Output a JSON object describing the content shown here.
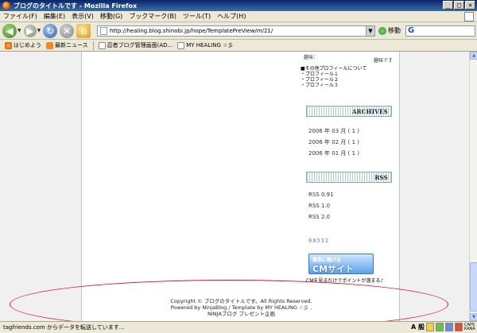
{
  "window": {
    "title": "ブログのタイトルです - Mozilla Firefox",
    "min": "_",
    "max": "□",
    "close": "×"
  },
  "menu": [
    "ファイル(F)",
    "編集(E)",
    "表示(V)",
    "移動(G)",
    "ブックマーク(B)",
    "ツール(T)",
    "ヘルプ(H)"
  ],
  "nav": {
    "url": "http://healing.blog.shinobi.jp/hope/TemplatePreView/m/21/",
    "go_label": "移動",
    "search_placeholder": ""
  },
  "bookmarks": [
    "はじめよう",
    "最新ニュース",
    "忍者ブログ管理画面(AD...",
    "MY HEALING ☆彡"
  ],
  "sidebar": {
    "profile_label": "趣味：",
    "profile_hobby": "趣味です",
    "other_profile": {
      "heading": "■その他プロフィールについて",
      "items": [
        "・プロフィール１",
        "・プロフィール２",
        "・プロフィール３"
      ]
    },
    "archives_heading": "ARCHIVES",
    "archives": [
      "2006 年 03 月 ( 1 )",
      "2006 年 02 月 ( 1 )",
      "2006 年 01 月 ( 1 )"
    ],
    "rss_heading": "RSS",
    "rss_links": [
      "RSS 0.91",
      "RSS 1.0",
      "RSS 2.0"
    ],
    "counter": "00331",
    "cm_banner": {
      "top": "簡単に稼げる",
      "main": "CMサイト",
      "caption": "CMを見るだけでポイントが溜まる♪"
    }
  },
  "footer": {
    "line1": "Copyright © ブログのタイトルです。All Rights Reserved.",
    "line2": "Powered by NinjaBlog / Template by MY HEALING ☆彡 .",
    "line3": "NINJAブログ プレゼント企画"
  },
  "status": {
    "text": "tagfriends.com からデータを転送しています...",
    "ime": "A 般",
    "caps": "CAPS KANA"
  },
  "colors": {
    "annotation": "#e0101a",
    "accent_title": "#0a246a"
  }
}
